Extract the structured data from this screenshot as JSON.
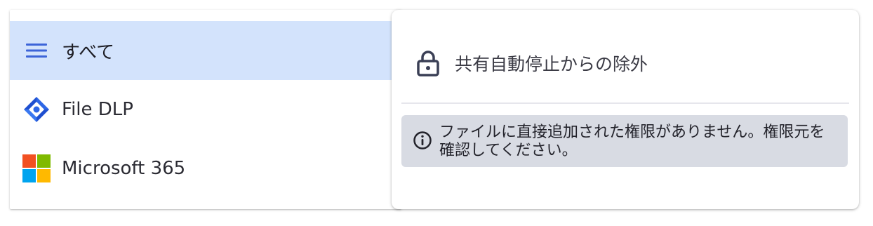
{
  "sidebar": {
    "items": [
      {
        "label": "すべて",
        "icon": "hamburger-menu-icon",
        "active": true
      },
      {
        "label": "File DLP",
        "icon": "file-dlp-logo-icon",
        "active": false
      },
      {
        "label": "Microsoft 365",
        "icon": "microsoft-logo-icon",
        "active": false
      }
    ]
  },
  "panel": {
    "header": {
      "icon": "lock-icon",
      "title": "共有自動停止からの除外"
    },
    "info": {
      "icon": "info-circle-icon",
      "message": "ファイルに直接追加された権限がありません。権限元を確認してください。"
    }
  },
  "colors": {
    "active_item_bg": "#d3e3fc",
    "info_box_bg": "#d8dbe3",
    "accent_blue": "#2f5fd6",
    "ms_red": "#f25022",
    "ms_green": "#7fba00",
    "ms_blue": "#00a4ef",
    "ms_yellow": "#ffb900"
  }
}
